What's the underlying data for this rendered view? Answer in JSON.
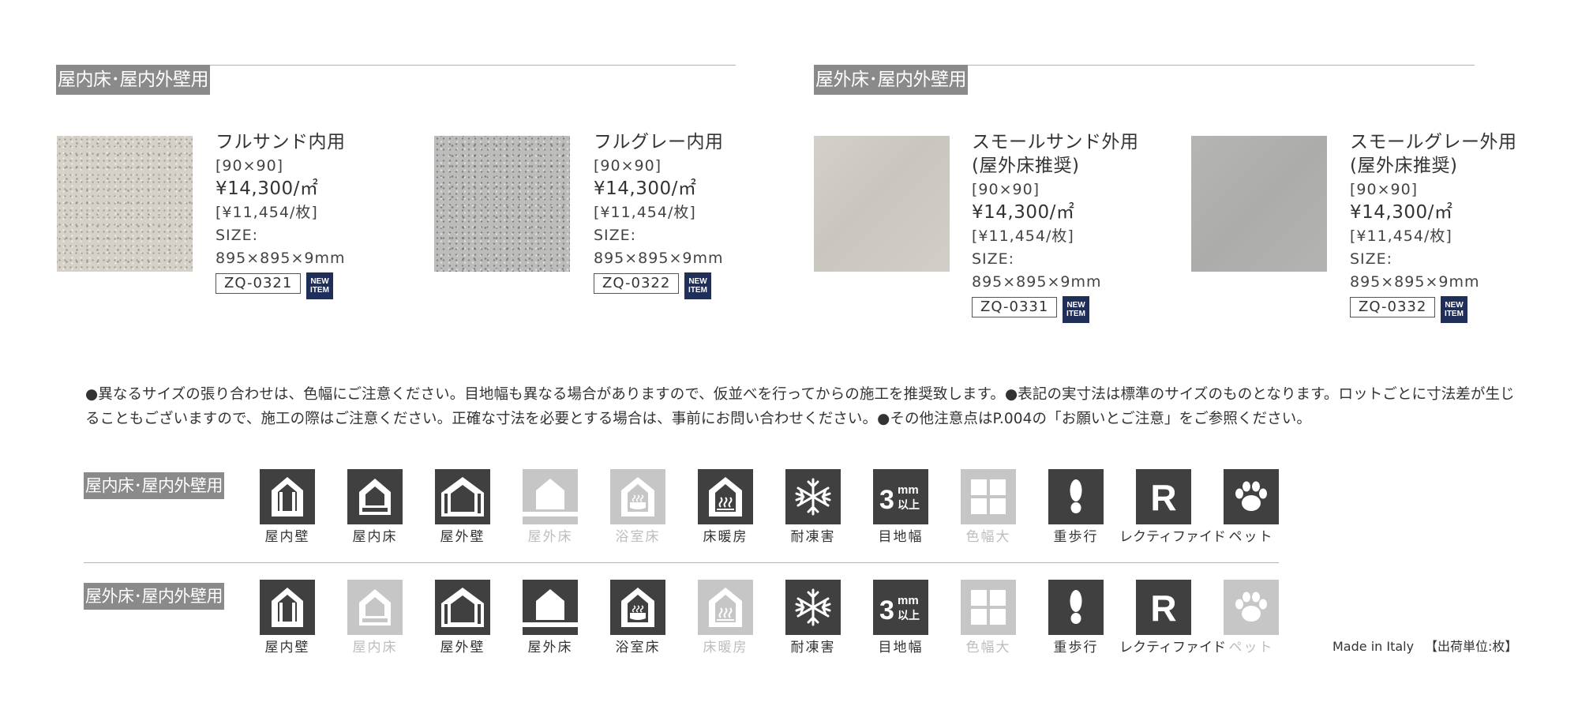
{
  "sections": {
    "indoor_label": "屋内床･屋内外壁用",
    "outdoor_label": "屋外床･屋内外壁用"
  },
  "products": [
    {
      "name": "フルサンド内用",
      "name2": "",
      "size_code": "[90×90]",
      "price": "¥14,300/㎡",
      "unit_price": "[¥11,454/枚]",
      "size_label": "SIZE:",
      "size": "895×895×9mm",
      "code": "ZQ-0321",
      "badge_line1": "NEW",
      "badge_line2": "ITEM"
    },
    {
      "name": "フルグレー内用",
      "name2": "",
      "size_code": "[90×90]",
      "price": "¥14,300/㎡",
      "unit_price": "[¥11,454/枚]",
      "size_label": "SIZE:",
      "size": "895×895×9mm",
      "code": "ZQ-0322",
      "badge_line1": "NEW",
      "badge_line2": "ITEM"
    },
    {
      "name": "スモールサンド外用",
      "name2": "(屋外床推奨)",
      "size_code": "[90×90]",
      "price": "¥14,300/㎡",
      "unit_price": "[¥11,454/枚]",
      "size_label": "SIZE:",
      "size": "895×895×9mm",
      "code": "ZQ-0331",
      "badge_line1": "NEW",
      "badge_line2": "ITEM"
    },
    {
      "name": "スモールグレー外用",
      "name2": "(屋外床推奨)",
      "size_code": "[90×90]",
      "price": "¥14,300/㎡",
      "unit_price": "[¥11,454/枚]",
      "size_label": "SIZE:",
      "size": "895×895×9mm",
      "code": "ZQ-0332",
      "badge_line1": "NEW",
      "badge_line2": "ITEM"
    }
  ],
  "notes": {
    "line1": "●異なるサイズの張り合わせは、色幅にご注意ください。目地幅も異なる場合がありますので、仮並べを行ってからの施工を推奨致します。●表記の実寸法は標準のサイズのものとなります。ロットごとに寸法差が生じ",
    "line2": "ることもございますので、施工の際はご注意ください。正確な寸法を必要とする場合は、事前にお問い合わせください。●その他注意点はP.004の「お願いとご注意」をご参照ください。"
  },
  "usage": {
    "row1_label": "屋内床･屋内外壁用",
    "row2_label": "屋外床･屋内外壁用",
    "labels": [
      "屋内壁",
      "屋内床",
      "屋外壁",
      "屋外床",
      "浴室床",
      "床暖房",
      "耐凍害",
      "目地幅",
      "色幅大",
      "重歩行",
      "レクティファイド",
      "ペット"
    ],
    "icon_names": [
      "indoor-wall-icon",
      "indoor-floor-icon",
      "outdoor-wall-icon",
      "outdoor-floor-icon",
      "bathroom-floor-icon",
      "floor-heating-icon",
      "frost-resistant-icon",
      "joint-width-icon",
      "color-variation-icon",
      "heavy-traffic-icon",
      "rectified-icon",
      "pet-icon"
    ],
    "row1_active": [
      true,
      true,
      true,
      false,
      false,
      true,
      true,
      true,
      false,
      true,
      true,
      true
    ],
    "row2_active": [
      true,
      false,
      true,
      true,
      true,
      false,
      true,
      true,
      false,
      true,
      true,
      false
    ],
    "joint_mm": "3",
    "joint_unit": "mm",
    "joint_suffix": "以上",
    "rectified_letter": "R"
  },
  "colors": {
    "icon_active": "#404040",
    "icon_inactive": "#c6c6c6",
    "label_bg": "#8a8a8a",
    "badge_bg": "#1f2f5a"
  },
  "footer": {
    "origin": "Made in Italy",
    "unit": "【出荷単位:枚】"
  }
}
